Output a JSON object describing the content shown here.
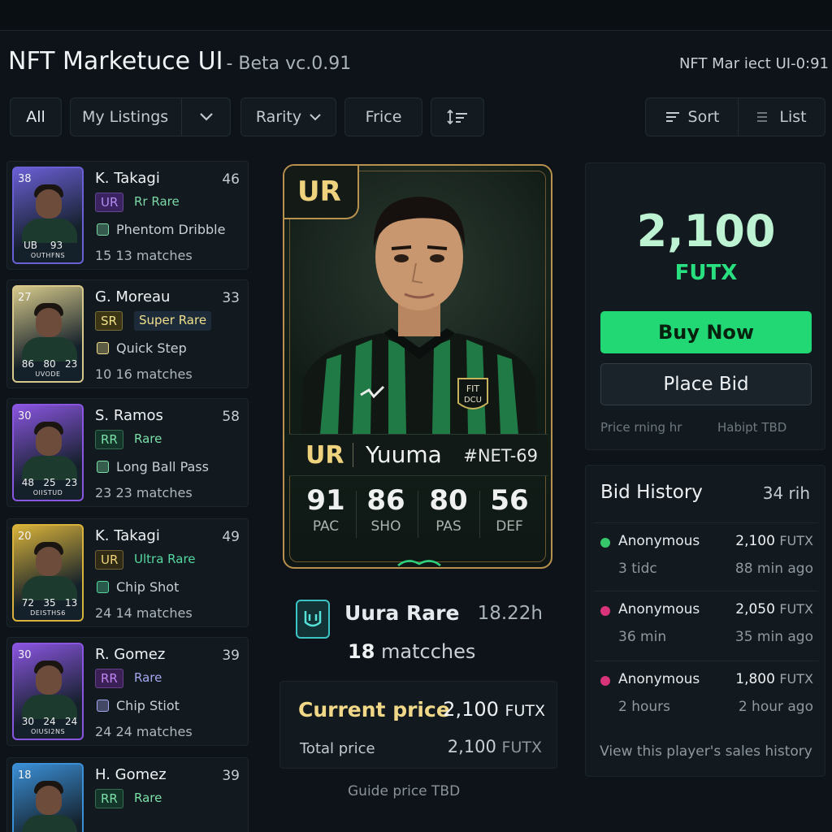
{
  "header": {
    "title": "NFT Marketuce UI",
    "version": "- Beta vc.0.91",
    "right_label": "NFT Mar iect UI-0:91"
  },
  "filters": {
    "all": "All",
    "my_listings": "My Listings",
    "rarity": "Rarity",
    "price": "Frice",
    "sort": "Sort",
    "list": "List"
  },
  "players": [
    {
      "name": "K. Takagi",
      "rating": "46",
      "badge": "UR",
      "rarity": "Rr  Rare",
      "skill": "Phentom Dribble",
      "matches": "15  13 matches",
      "thumb_num": "38",
      "thumb_stats": [
        "UB",
        "93",
        ""
      ],
      "thumb_name": "OUTHFNS",
      "theme": "#6b5fd6",
      "badge_color": "#b28cf0",
      "badge_bg": "#3a2360",
      "label_color": "#7bd7a5"
    },
    {
      "name": "G. Moreau",
      "rating": "33",
      "badge": "SR",
      "rarity": "Super Rare",
      "skill": "Quick Step",
      "matches": "10  16 matches",
      "thumb_num": "27",
      "thumb_stats": [
        "86",
        "80",
        "23"
      ],
      "thumb_name": "UVODE",
      "theme": "#d6c98b",
      "badge_color": "#f0e08c",
      "badge_bg": "#3b3514",
      "label_color": "#f0e08c"
    },
    {
      "name": "S. Ramos",
      "rating": "58",
      "badge": "RR",
      "rarity": "Rare",
      "skill": "Long Ball Pass",
      "matches": "23  23 matches",
      "thumb_num": "30",
      "thumb_stats": [
        "48",
        "25",
        "23"
      ],
      "thumb_name": "OIISTUD",
      "theme": "#8a55e0",
      "badge_color": "#7be0a8",
      "badge_bg": "#14352a",
      "label_color": "#7be0a8"
    },
    {
      "name": "K. Takagi",
      "rating": "49",
      "badge": "UR",
      "rarity": "Ultra Rare",
      "skill": "Chip Shot",
      "matches": "24  14 matches",
      "thumb_num": "20",
      "thumb_stats": [
        "72",
        "35",
        "13"
      ],
      "thumb_name": "DEISTHS6",
      "theme": "#d8b23a",
      "badge_color": "#f0d27a",
      "badge_bg": "#2f2a15",
      "label_color": "#54d8a0"
    },
    {
      "name": "R. Gomez",
      "rating": "39",
      "badge": "RR",
      "rarity": "Rare",
      "skill": "Chip Stiot",
      "matches": "24  24 matches",
      "thumb_num": "30",
      "thumb_stats": [
        "30",
        "24",
        "24"
      ],
      "thumb_name": "OIUSI2NS",
      "theme": "#8a55e0",
      "badge_color": "#c083f0",
      "badge_bg": "#3a2055",
      "label_color": "#a5a8f0"
    },
    {
      "name": "H. Gomez",
      "rating": "39",
      "badge": "RR",
      "rarity": "Rare",
      "skill": "",
      "matches": "",
      "thumb_num": "18",
      "thumb_stats": [
        "",
        "",
        ""
      ],
      "thumb_name": "",
      "theme": "#3b8fd6",
      "badge_color": "#7be0a8",
      "badge_bg": "#14352a",
      "label_color": "#7be0a8"
    }
  ],
  "featured": {
    "rarity": "UR",
    "name": "Yuuma",
    "token_id": "#NET-69",
    "jersey_text": "FIT DCU",
    "stats": [
      {
        "value": "91",
        "label": "PAC"
      },
      {
        "value": "86",
        "label": "SHO"
      },
      {
        "value": "80",
        "label": "PAS"
      },
      {
        "value": "56",
        "label": "DEF"
      }
    ],
    "rarity_name": "Uura Rare",
    "time_left": "18.22h",
    "matches_num": "18",
    "matches_label": "matcches",
    "current_price_label": "Current price",
    "current_price": "2,100",
    "current_unit": "FUTX",
    "total_price_label": "Total price",
    "total_price": "2,100",
    "total_unit": "FUTX",
    "guide": "Guide price  TBD"
  },
  "buy_panel": {
    "price": "2,100",
    "unit": "FUTX",
    "buy_label": "Buy Now",
    "bid_label": "Place Bid",
    "note_left": "Price rning hr",
    "note_right": "Habipt TBD"
  },
  "bid_history": {
    "title": "Bid History",
    "count": "34 rih",
    "rows": [
      {
        "who": "Anonymous",
        "amount": "2,100",
        "unit": "FUTX",
        "sub": "3 tidc",
        "ago": "88 min ago",
        "dot": "#36c86a"
      },
      {
        "who": "Anonymous",
        "amount": "2,050",
        "unit": "FUTX",
        "sub": "36 min",
        "ago": "35 min ago",
        "dot": "#d8347a"
      },
      {
        "who": "Anonymous",
        "amount": "1,800",
        "unit": "FUTX",
        "sub": "2 hours",
        "ago": "2 hour ago",
        "dot": "#d8347a"
      }
    ],
    "link": "View this player's sales history"
  }
}
